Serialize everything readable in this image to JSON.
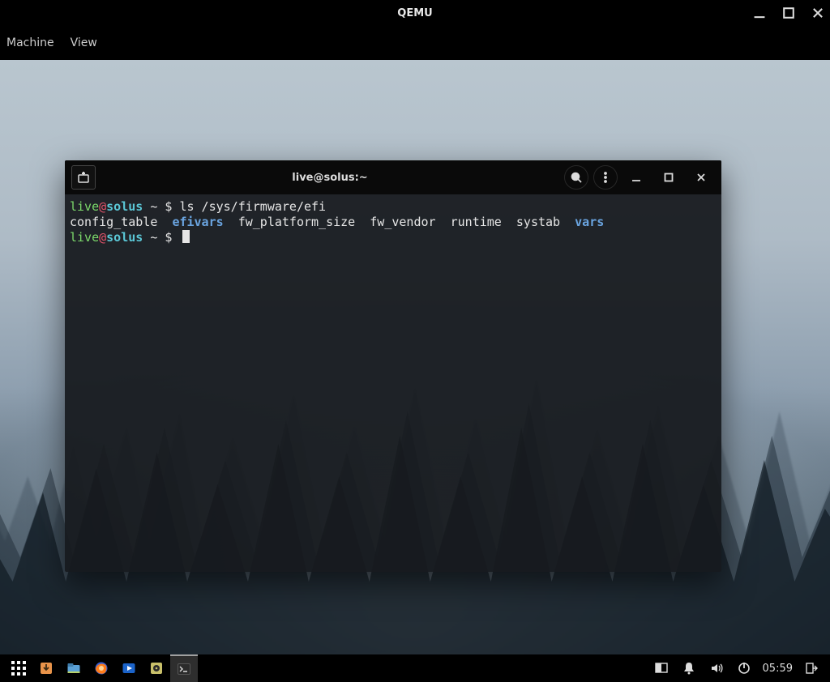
{
  "outer_window": {
    "title": "QEMU",
    "menu": {
      "machine": "Machine",
      "view": "View"
    }
  },
  "terminal": {
    "title": "live@solus:~",
    "prompt": {
      "user": "live",
      "at": "@",
      "host": "solus",
      "path_sigil": " ~ $ "
    },
    "command1": "ls /sys/firmware/efi",
    "ls_output": {
      "items": [
        "config_table",
        "efivars",
        "fw_platform_size",
        "fw_vendor",
        "runtime",
        "systab",
        "vars"
      ],
      "dir_color_items": [
        "efivars",
        "vars"
      ]
    },
    "line2_text": "config_table  efivars  fw_platform_size  fw_vendor  runtime  systab  vars"
  },
  "panel": {
    "clock": "05:59"
  }
}
